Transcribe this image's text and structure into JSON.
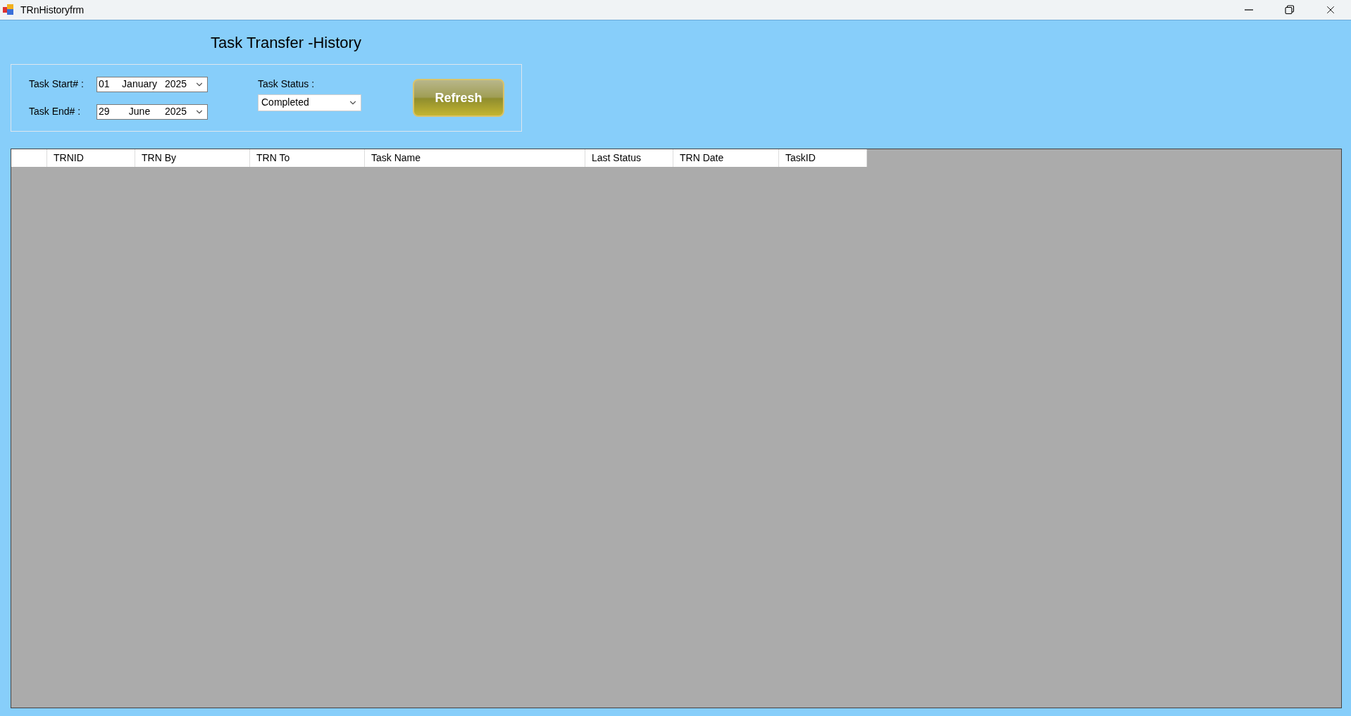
{
  "window": {
    "title": "TRnHistoryfrm"
  },
  "heading": "Task Transfer -History",
  "filters": {
    "start": {
      "label": "Task Start# :",
      "day": "01",
      "month": "January",
      "year": "2025"
    },
    "end": {
      "label": "Task End# :",
      "day": "29",
      "month": "June",
      "year": "2025"
    },
    "status": {
      "label": "Task Status :",
      "value": "Completed"
    },
    "refresh_button": "Refresh"
  },
  "table": {
    "columns": [
      "TRNID",
      "TRN By",
      "TRN To",
      "Task Name",
      "Last Status",
      "TRN Date",
      "TaskID"
    ]
  }
}
